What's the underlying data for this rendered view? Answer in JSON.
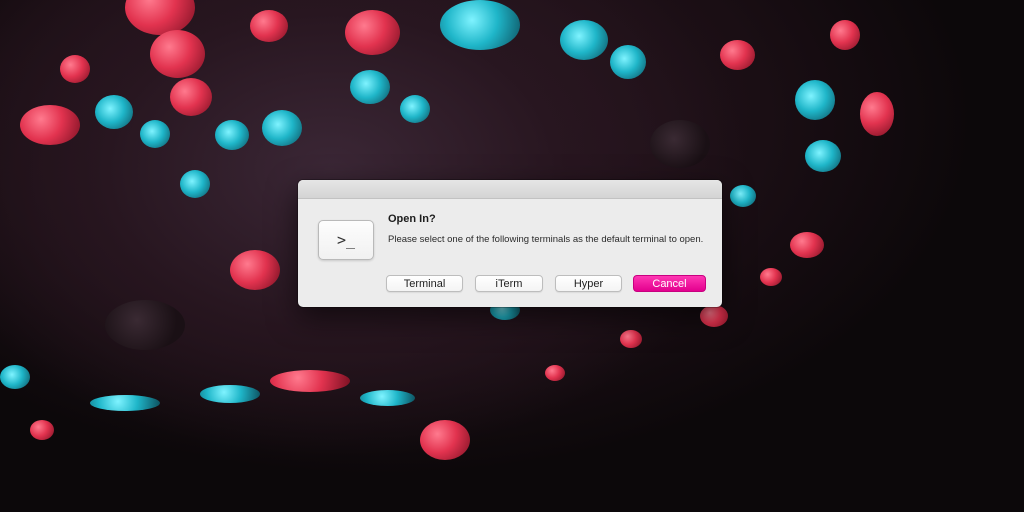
{
  "dialog": {
    "icon": "terminal-prompt-icon",
    "icon_glyph": ">_",
    "title": "Open In?",
    "message": "Please select one of the following terminals as the default terminal to open.",
    "buttons": {
      "terminal": "Terminal",
      "iterm": "iTerm",
      "hyper": "Hyper",
      "cancel": "Cancel"
    },
    "accent_color": "#f0009b"
  }
}
